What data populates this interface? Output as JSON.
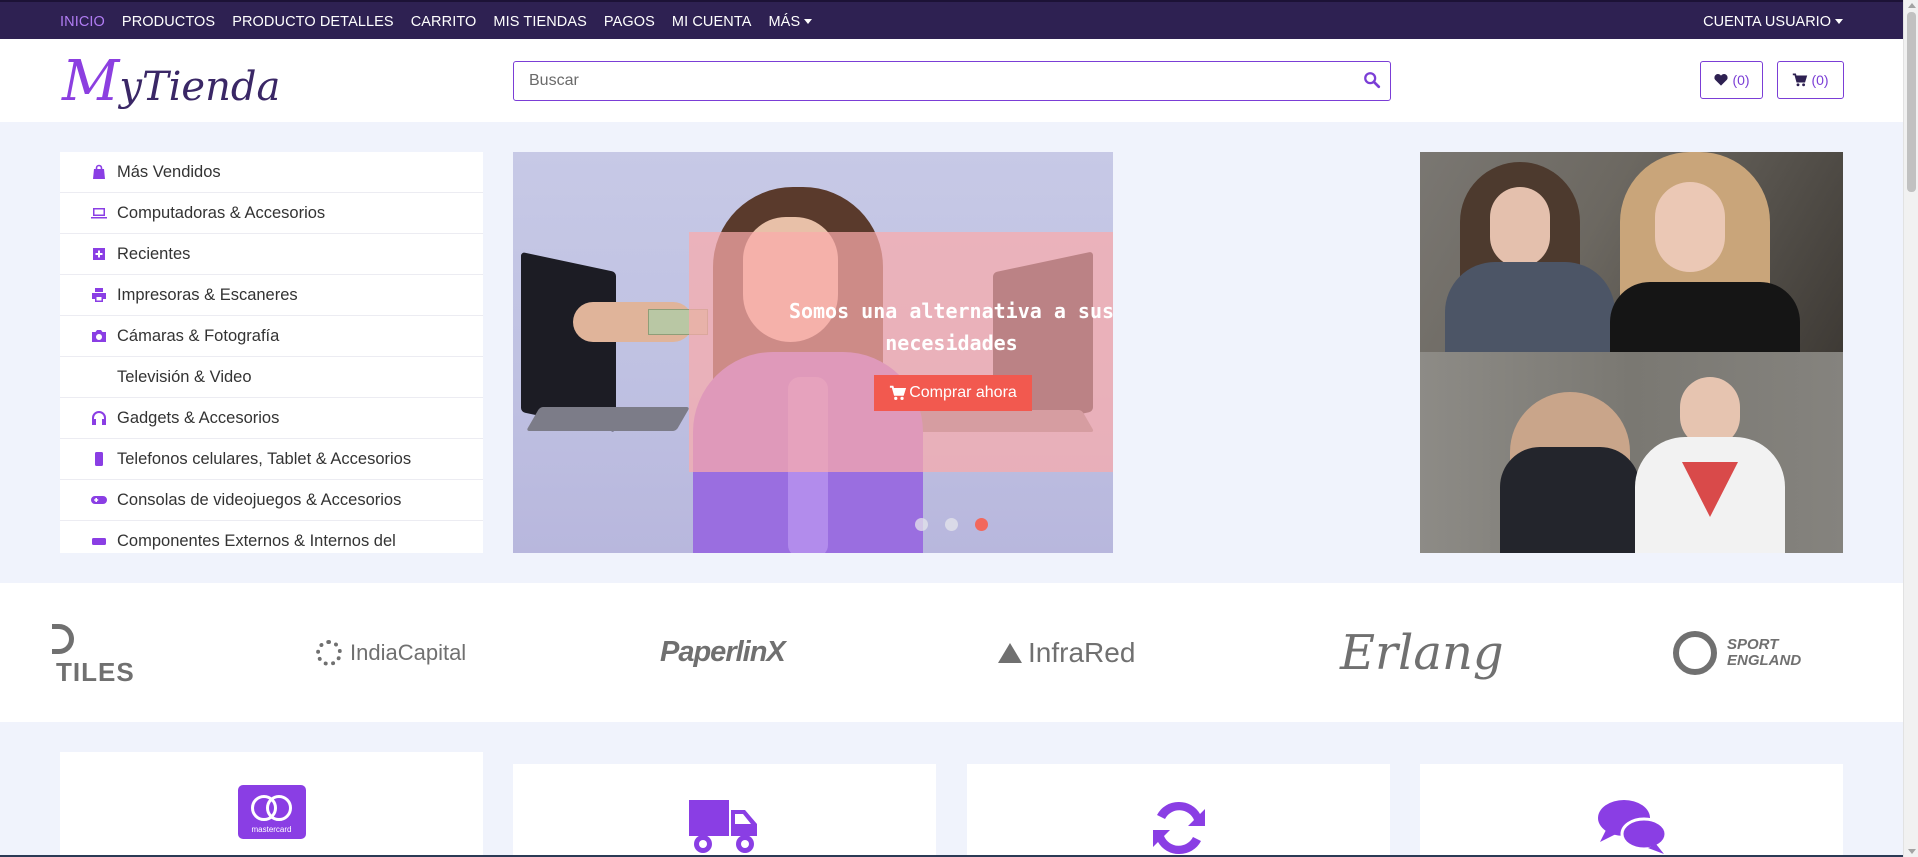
{
  "topnav": {
    "items": [
      {
        "label": "INICIO",
        "active": true
      },
      {
        "label": "PRODUCTOS",
        "active": false
      },
      {
        "label": "PRODUCTO DETALLES",
        "active": false
      },
      {
        "label": "CARRITO",
        "active": false
      },
      {
        "label": "MIS TIENDAS",
        "active": false
      },
      {
        "label": "PAGOS",
        "active": false
      },
      {
        "label": "MI CUENTA",
        "active": false
      },
      {
        "label": "MÁS",
        "active": false
      }
    ],
    "account_label": "CUENTA USUARIO"
  },
  "header": {
    "logo_first": "M",
    "logo_rest": "yTienda",
    "search_placeholder": "Buscar",
    "wishlist_count": "(0)",
    "cart_count": "(0)"
  },
  "categories": [
    {
      "label": "Más Vendidos",
      "icon": "shopping-bag-icon"
    },
    {
      "label": "Computadoras & Accesorios",
      "icon": "laptop-icon"
    },
    {
      "label": "Recientes",
      "icon": "plus-square-icon"
    },
    {
      "label": "Impresoras & Escaneres",
      "icon": "printer-icon"
    },
    {
      "label": "Cámaras & Fotografía",
      "icon": "camera-icon"
    },
    {
      "label": "Televisión & Video",
      "icon": ""
    },
    {
      "label": "Gadgets & Accesorios",
      "icon": "headphones-icon"
    },
    {
      "label": "Telefonos celulares, Tablet & Accesorios",
      "icon": "mobile-icon"
    },
    {
      "label": "Consolas de videojuegos & Accesorios",
      "icon": "gamepad-icon"
    },
    {
      "label": "Componentes Externos & Internos del",
      "icon": "hdd-icon"
    }
  ],
  "hero": {
    "headline": "Somos una alternativa a sus necesidades",
    "cta_label": "Comprar ahora",
    "active_slide": 3,
    "slide_count": 3
  },
  "brands": [
    "TILES",
    "IndiaCapital",
    "PaperlinX",
    "InfraRed",
    "Erlang",
    "SPORT ENGLAND"
  ],
  "features": [
    {
      "icon": "mastercard-icon",
      "card_text": "mastercard"
    },
    {
      "icon": "truck-icon"
    },
    {
      "icon": "refresh-icon"
    },
    {
      "icon": "chat-icon"
    }
  ],
  "colors": {
    "nav_bg": "#2e2152",
    "accent": "#8a3ee4",
    "cta": "#f2594f",
    "page_bg": "#f0f3fc"
  }
}
